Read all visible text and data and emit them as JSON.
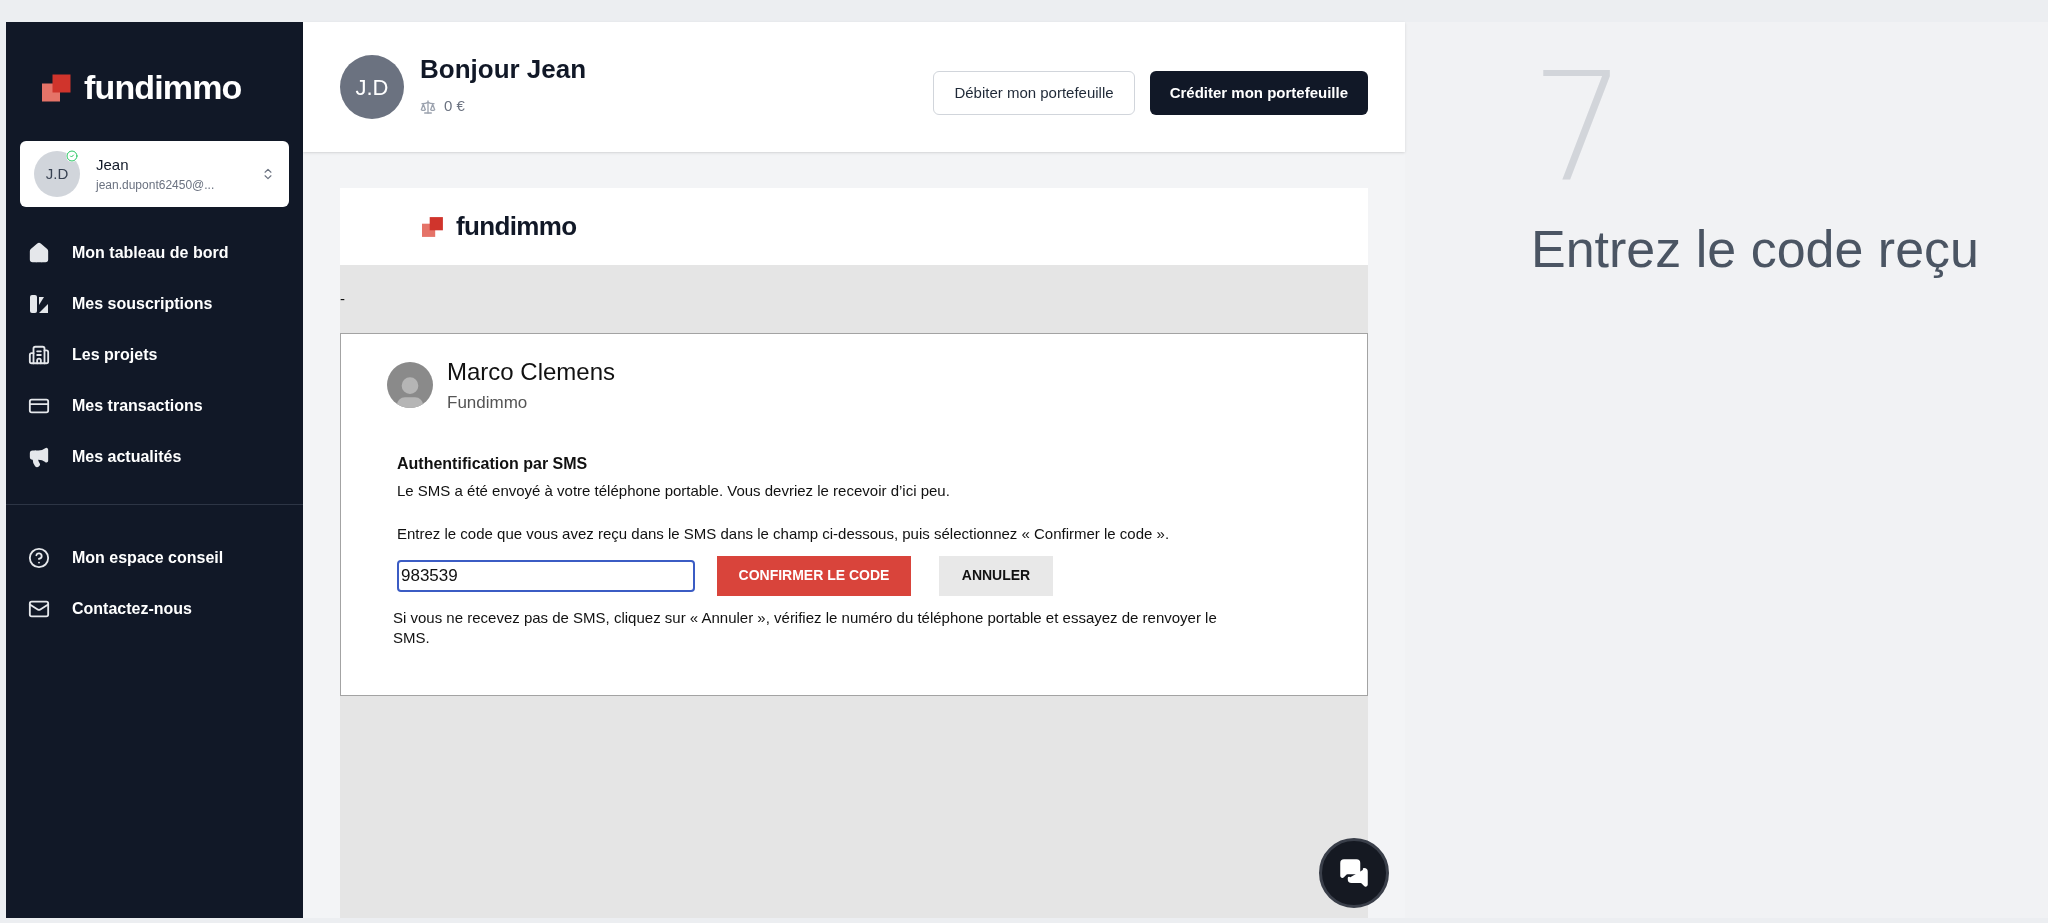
{
  "sidebar": {
    "brand": "fundimmo",
    "profile": {
      "initials": "J.D",
      "name": "Jean",
      "email": "jean.dupont62450@...",
      "verified": true
    },
    "nav": [
      {
        "label": "Mon tableau de bord"
      },
      {
        "label": "Mes souscriptions"
      },
      {
        "label": "Les projets"
      },
      {
        "label": "Mes transactions"
      },
      {
        "label": "Mes actualités"
      }
    ],
    "secondary_nav": [
      {
        "label": "Mon espace conseil"
      },
      {
        "label": "Contactez-nous"
      }
    ]
  },
  "header": {
    "initials": "J.D",
    "greeting": "Bonjour Jean",
    "balance": "0 €",
    "buttons": [
      {
        "label": "Débiter mon portefeuille",
        "kind": "outline"
      },
      {
        "label": "Créditer mon portefeuille",
        "kind": "primary"
      }
    ]
  },
  "embedded_page": {
    "brand": "fundimmo",
    "separator_text": "-",
    "dialog": {
      "sender_name": "Marco Clemens",
      "sender_org": "Fundimmo",
      "title": "Authentification par SMS",
      "sent_text": "Le SMS a été envoyé à votre téléphone portable. Vous devriez le recevoir d’ici peu.",
      "instruction": "Entrez le code que vous avez reçu dans le SMS dans le champ ci-dessous, puis sélectionnez « Confirmer le code ».",
      "code_value": "983539",
      "confirm_button": "CONFIRMER LE CODE",
      "cancel_button": "ANNULER",
      "help_text": "Si vous ne recevez pas de SMS, cliquez sur « Annuler », vérifiez le numéro du téléphone portable et essayez de renvoyer le SMS."
    }
  },
  "step": {
    "number": "7",
    "caption": "Entrez le code reçu"
  }
}
